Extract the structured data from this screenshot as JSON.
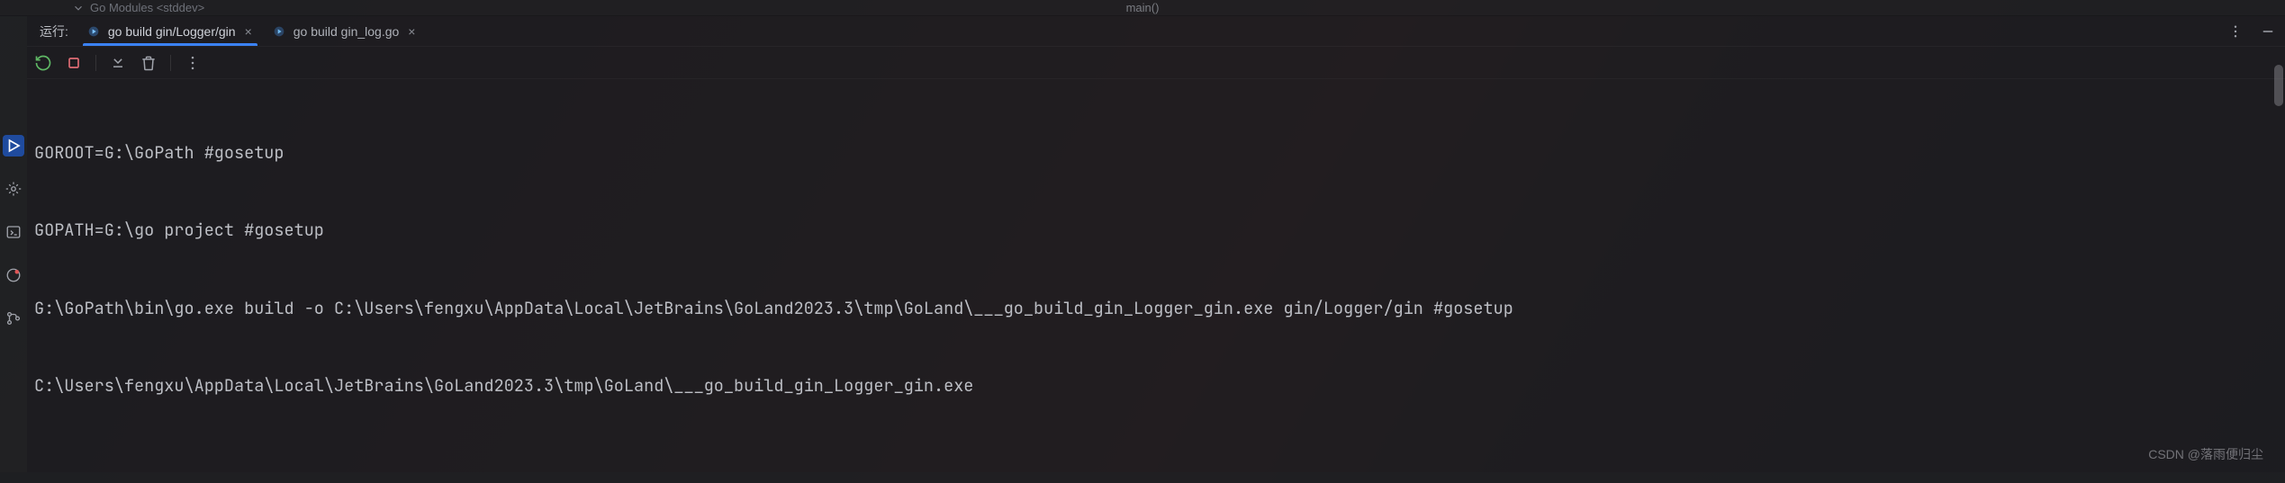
{
  "editor_top": {
    "tree_fragment": "Go Modules <stddev>",
    "breadcrumb": "main()"
  },
  "panel": {
    "title": "运行:",
    "tabs": [
      {
        "label": "go build gin/Logger/gin",
        "active": true
      },
      {
        "label": "go build gin_log.go",
        "active": false
      }
    ]
  },
  "console_lines": [
    "GOROOT=G:\\GoPath #gosetup",
    "GOPATH=G:\\go project #gosetup",
    "G:\\GoPath\\bin\\go.exe build -o C:\\Users\\fengxu\\AppData\\Local\\JetBrains\\GoLand2023.3\\tmp\\GoLand\\___go_build_gin_Logger_gin.exe gin/Logger/gin #gosetup",
    "C:\\Users\\fengxu\\AppData\\Local\\JetBrains\\GoLand2023.3\\tmp\\GoLand\\___go_build_gin_Logger_gin.exe"
  ],
  "watermark": "CSDN @落雨便归尘"
}
